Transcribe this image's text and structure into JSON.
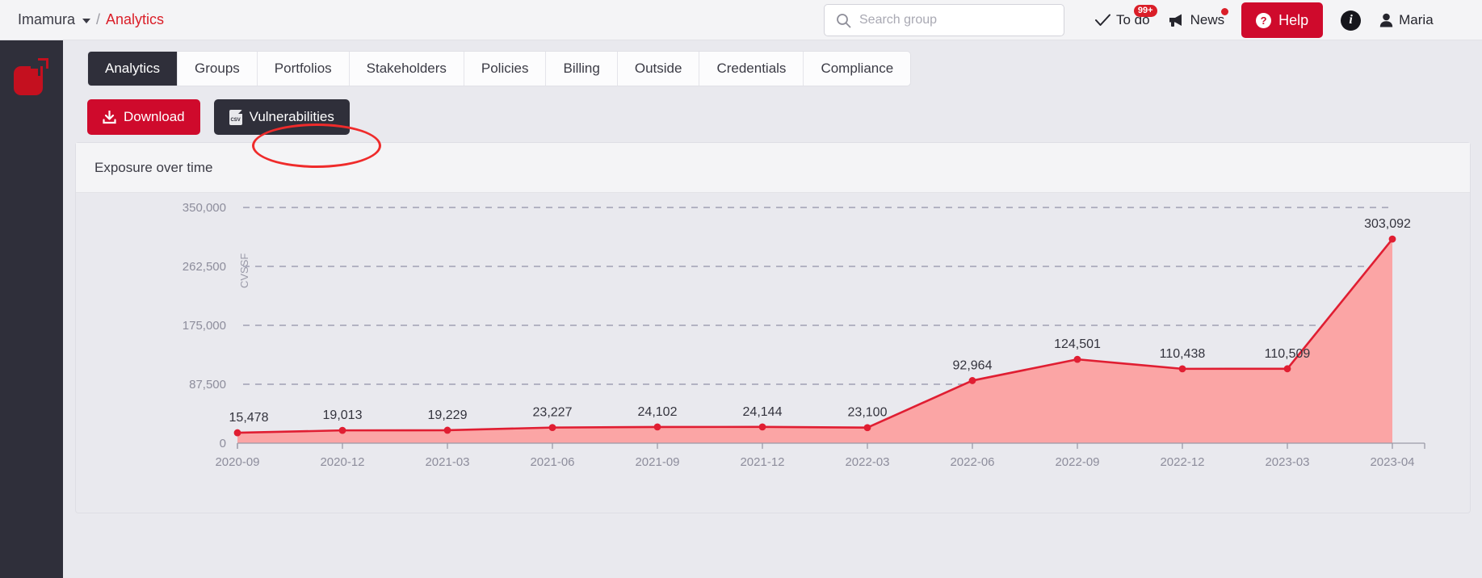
{
  "header": {
    "breadcrumb": {
      "org": "Imamura",
      "separator": "/",
      "current": "Analytics"
    },
    "search": {
      "placeholder": "Search group",
      "value": "",
      "icon": "search-icon"
    },
    "todo": {
      "label": "To do",
      "badge": "99+",
      "icon": "check-icon"
    },
    "news": {
      "label": "News",
      "icon": "megaphone-icon",
      "has_dot": true
    },
    "help": {
      "label": "Help",
      "icon": "question-circle-icon"
    },
    "info": {
      "label": "i",
      "icon": "info-circle-icon"
    },
    "user": {
      "label": "Maria",
      "icon": "user-icon"
    }
  },
  "sidebar": {
    "logo_name": "app-logo"
  },
  "tabs": [
    {
      "label": "Analytics",
      "active": true
    },
    {
      "label": "Groups",
      "active": false
    },
    {
      "label": "Portfolios",
      "active": false
    },
    {
      "label": "Stakeholders",
      "active": false
    },
    {
      "label": "Policies",
      "active": false
    },
    {
      "label": "Billing",
      "active": false
    },
    {
      "label": "Outside",
      "active": false
    },
    {
      "label": "Credentials",
      "active": false
    },
    {
      "label": "Compliance",
      "active": false
    }
  ],
  "toolbar": {
    "download_label": "Download",
    "download_icon": "download-icon",
    "vulnerabilities_label": "Vulnerabilities",
    "vulnerabilities_icon": "csv-file-icon"
  },
  "card": {
    "title": "Exposure over time"
  },
  "colors": {
    "brand_red": "#cf0a2c",
    "accent_red": "#da1e28",
    "line_red": "#e01e32",
    "area_red": "#fba5a5",
    "dark": "#2f2f3a",
    "annotation": "#ef2b2b"
  },
  "chart_data": {
    "type": "area",
    "title": "Exposure over time",
    "xlabel": "",
    "ylabel": "CVSSF",
    "categories": [
      "2020-09",
      "2020-12",
      "2021-03",
      "2021-06",
      "2021-09",
      "2021-12",
      "2022-03",
      "2022-06",
      "2022-09",
      "2022-12",
      "2023-03",
      "2023-04"
    ],
    "values": [
      15478,
      19013,
      19229,
      23227,
      24102,
      24144,
      23100,
      92964,
      124501,
      110438,
      110509,
      303092
    ],
    "value_labels": [
      "15,478",
      "19,013",
      "19,229",
      "23,227",
      "24,102",
      "24,144",
      "23,100",
      "92,964",
      "124,501",
      "110,438",
      "110,509",
      "303,092"
    ],
    "yticks": [
      0,
      87500,
      175000,
      262500,
      350000
    ],
    "ytick_labels": [
      "0",
      "87,500",
      "175,000",
      "262,500",
      "350,000"
    ],
    "ylim": [
      0,
      350000
    ],
    "grid": true,
    "legend": "none",
    "series": [
      {
        "name": "CVSSF",
        "values": [
          15478,
          19013,
          19229,
          23227,
          24102,
          24144,
          23100,
          92964,
          124501,
          110438,
          110509,
          303092
        ]
      }
    ]
  }
}
